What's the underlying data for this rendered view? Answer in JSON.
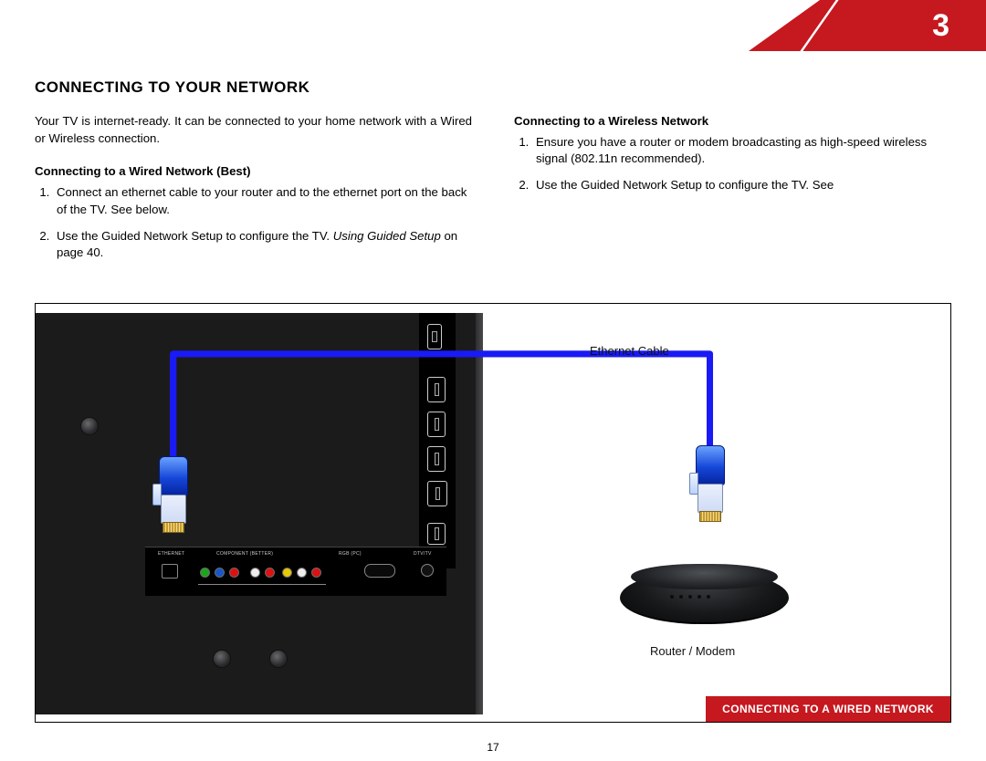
{
  "chapter_number": "3",
  "page_number": "17",
  "main_title": "CONNECTING TO YOUR NETWORK",
  "intro": "Your TV is internet-ready. It can be connected to your home network with a Wired or Wireless connection.",
  "wired": {
    "heading": "Connecting to a Wired Network (Best)",
    "step1": "Connect an ethernet cable to your router and to the ethernet port on the back of the TV. See below.",
    "step2_a": "Use the Guided Network Setup to configure the TV. ",
    "step2_b_ital": "Using Guided Setup",
    "step2_c": " on page 40."
  },
  "wireless": {
    "heading": "Connecting to a Wireless Network",
    "step1": "Ensure you have a router or modem broadcasting as high-speed wireless signal (802.11n recommended).",
    "step2": "Use the Guided Network Setup to configure the TV. See"
  },
  "diagram": {
    "cable_label": "Ethernet Cable",
    "router_label": "Router / Modem",
    "caption": "CONNECTING TO A WIRED NETWORK",
    "bottom_ports": {
      "ethernet": "ETHERNET",
      "component": "COMPONENT (BETTER)",
      "rgb": "RGB (PC)",
      "dtv": "DTV/TV"
    }
  }
}
